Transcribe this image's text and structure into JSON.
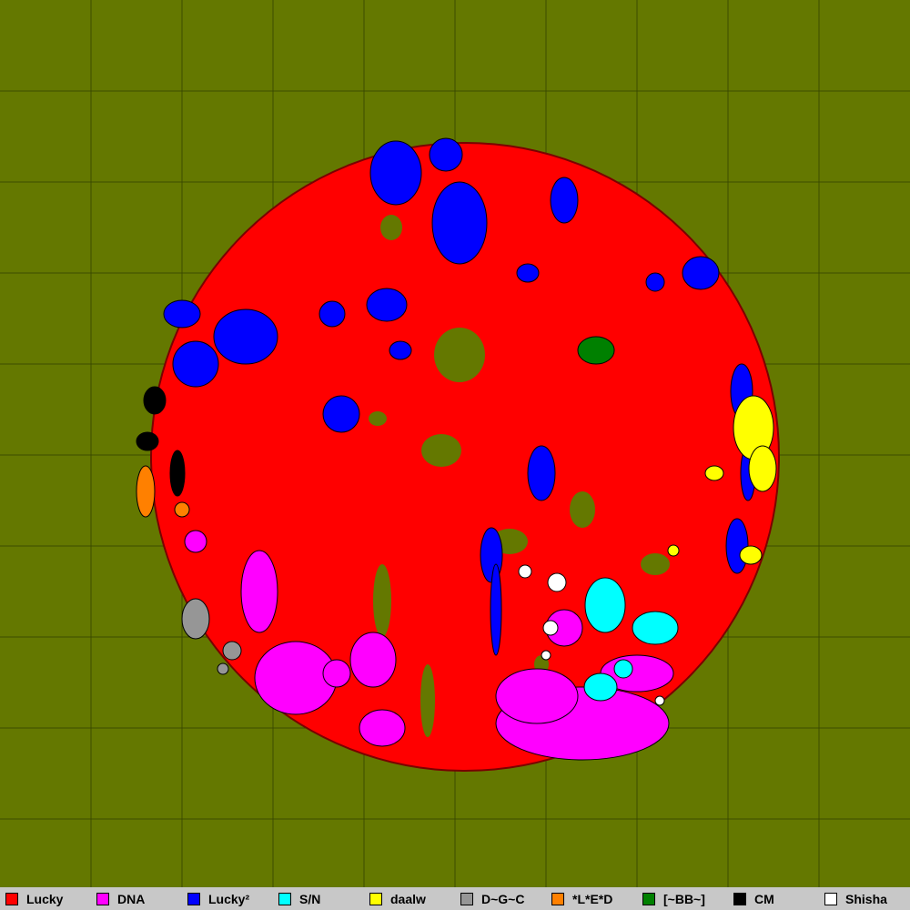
{
  "map": {
    "background": "#647800",
    "grid_color": "#3c4c00",
    "grid_cells": 10,
    "unclaimed_color": "#647800"
  },
  "legend": [
    {
      "name": "Lucky",
      "color": "#ff0000"
    },
    {
      "name": "DNA",
      "color": "#ff00ff"
    },
    {
      "name": "Lucky²",
      "color": "#0000ff"
    },
    {
      "name": "S/N",
      "color": "#00ffff"
    },
    {
      "name": "daalw",
      "color": "#ffff00"
    },
    {
      "name": "D~G~C",
      "color": "#969696"
    },
    {
      "name": "*L*E*D",
      "color": "#ff8000"
    },
    {
      "name": "[~BB~]",
      "color": "#008000"
    },
    {
      "name": "CM",
      "color": "#000000"
    },
    {
      "name": "Shisha",
      "color": "#ffffff"
    }
  ]
}
